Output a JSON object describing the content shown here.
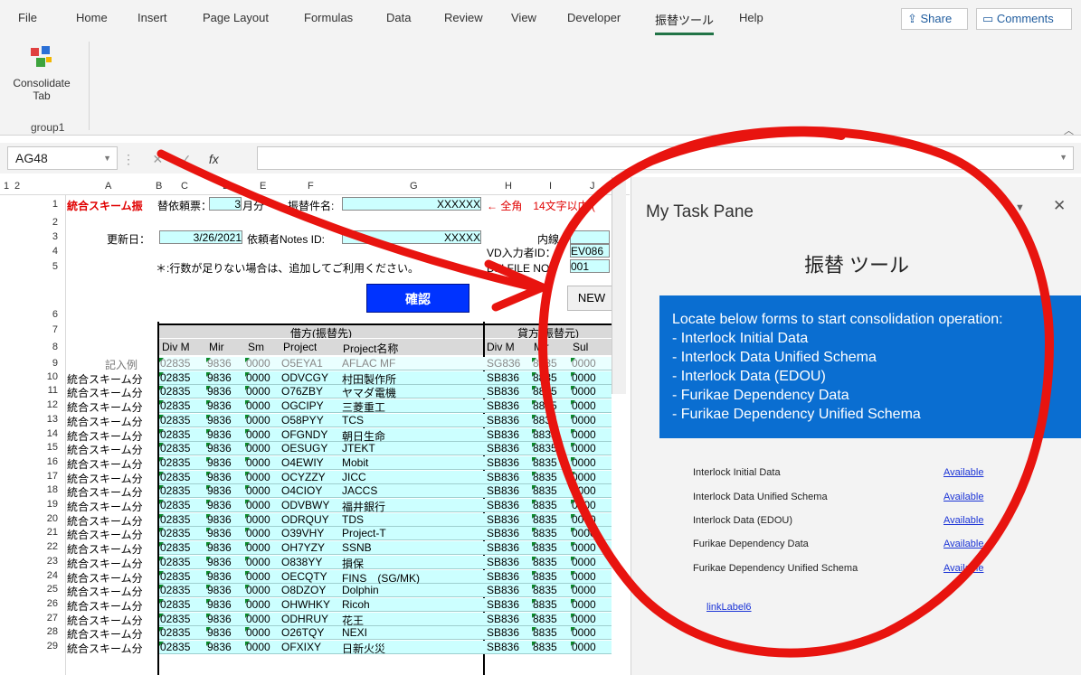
{
  "ribbon_tabs": [
    "File",
    "Home",
    "Insert",
    "Page Layout",
    "Formulas",
    "Data",
    "Review",
    "View",
    "Developer",
    "振替ツール",
    "Help"
  ],
  "share_label": "Share",
  "comments_label": "Comments",
  "consolidate_label_1": "Consolidate",
  "consolidate_label_2": "Tab",
  "group_label": "group1",
  "name_box": "AG48",
  "fx": "fx",
  "col_headers": [
    "A",
    "B",
    "C",
    "D",
    "E",
    "F",
    "G",
    "H",
    "I",
    "J"
  ],
  "outline_levels": [
    "1",
    "2"
  ],
  "header_rows": {
    "r1_title": "統合スキーム振",
    "r1_label": "替依頼票：",
    "r1_month": "3",
    "r1_month_unit": "月分",
    "r1_label2": "振替件名:",
    "r1_value": "XXXXXX",
    "r1_note": "← 全角　14文字以内 (",
    "r3_label": "更新日：",
    "r3_date": "3/26/2021",
    "r3_label2": "依頼者Notes ID:",
    "r3_value": "XXXXX",
    "r3_label3": "内線",
    "r4_label": "VD入力者ID：",
    "r4_value": "EV086",
    "r5_note": "＊:行数が足りない場合は、追加してご利用ください。",
    "r5_label": "DFI FILE NO.：",
    "r5_value": "001",
    "confirm_button": "確認",
    "new_button": "NEW",
    "r7_debit": "借方(振替先)",
    "r7_credit": "貸方(振替元)",
    "r8_cols": [
      "Div M",
      "Mir",
      "Sm",
      "Project",
      "Project名称",
      "Div M",
      "Mir",
      "Sul"
    ],
    "r9_example": "記入例"
  },
  "rows": [
    {
      "n": "9",
      "a": "",
      "c": "02835",
      "d": "9836",
      "e": "0000",
      "f": "O5EYA1",
      "g": "AFLAC MF",
      "h": "SG836",
      "i": "8835",
      "j": "0000"
    },
    {
      "n": "10",
      "a": "統合スキーム分",
      "c": "02835",
      "d": "9836",
      "e": "0000",
      "f": "ODVCGY",
      "g": "村田製作所",
      "h": "SB836",
      "i": "8835",
      "j": "0000"
    },
    {
      "n": "11",
      "a": "統合スキーム分",
      "c": "02835",
      "d": "9836",
      "e": "0000",
      "f": "O76ZBY",
      "g": "ヤマダ電機",
      "h": "SB836",
      "i": "8835",
      "j": "0000"
    },
    {
      "n": "12",
      "a": "統合スキーム分",
      "c": "02835",
      "d": "9836",
      "e": "0000",
      "f": "OGCIPY",
      "g": "三菱重工",
      "h": "SB836",
      "i": "8835",
      "j": "0000"
    },
    {
      "n": "13",
      "a": "統合スキーム分",
      "c": "02835",
      "d": "9836",
      "e": "0000",
      "f": "O58PYY",
      "g": "TCS",
      "h": "SB836",
      "i": "8835",
      "j": "0000"
    },
    {
      "n": "14",
      "a": "統合スキーム分",
      "c": "02835",
      "d": "9836",
      "e": "0000",
      "f": "OFGNDY",
      "g": "朝日生命",
      "h": "SB836",
      "i": "8835",
      "j": "0000"
    },
    {
      "n": "15",
      "a": "統合スキーム分",
      "c": "02835",
      "d": "9836",
      "e": "0000",
      "f": "OESUGY",
      "g": "JTEKT",
      "h": "SB836",
      "i": "8835",
      "j": "0000"
    },
    {
      "n": "16",
      "a": "統合スキーム分",
      "c": "02835",
      "d": "9836",
      "e": "0000",
      "f": "O4EWIY",
      "g": "Mobit",
      "h": "SB836",
      "i": "8835",
      "j": "0000"
    },
    {
      "n": "17",
      "a": "統合スキーム分",
      "c": "02835",
      "d": "9836",
      "e": "0000",
      "f": "OCYZZY",
      "g": "JICC",
      "h": "SB836",
      "i": "8835",
      "j": "0000"
    },
    {
      "n": "18",
      "a": "統合スキーム分",
      "c": "02835",
      "d": "9836",
      "e": "0000",
      "f": "O4CIOY",
      "g": "JACCS",
      "h": "SB836",
      "i": "8835",
      "j": "0000"
    },
    {
      "n": "19",
      "a": "統合スキーム分",
      "c": "02835",
      "d": "9836",
      "e": "0000",
      "f": "ODVBWY",
      "g": "福井銀行",
      "h": "SB836",
      "i": "8835",
      "j": "0000"
    },
    {
      "n": "20",
      "a": "統合スキーム分",
      "c": "02835",
      "d": "9836",
      "e": "0000",
      "f": "ODRQUY",
      "g": "TDS",
      "h": "SB836",
      "i": "8835",
      "j": "0000"
    },
    {
      "n": "21",
      "a": "統合スキーム分",
      "c": "02835",
      "d": "9836",
      "e": "0000",
      "f": "O39VHY",
      "g": "Project-T",
      "h": "SB836",
      "i": "8835",
      "j": "0000"
    },
    {
      "n": "22",
      "a": "統合スキーム分",
      "c": "02835",
      "d": "9836",
      "e": "0000",
      "f": "OH7YZY",
      "g": "SSNB",
      "h": "SB836",
      "i": "8835",
      "j": "0000"
    },
    {
      "n": "23",
      "a": "統合スキーム分",
      "c": "02835",
      "d": "9836",
      "e": "0000",
      "f": "O838YY",
      "g": "損保",
      "h": "SB836",
      "i": "8835",
      "j": "0000"
    },
    {
      "n": "24",
      "a": "統合スキーム分",
      "c": "02835",
      "d": "9836",
      "e": "0000",
      "f": "OECQTY",
      "g": "FINS　(SG/MK)",
      "h": "SB836",
      "i": "8835",
      "j": "0000"
    },
    {
      "n": "25",
      "a": "統合スキーム分",
      "c": "02835",
      "d": "9836",
      "e": "0000",
      "f": "O8DZOY",
      "g": "Dolphin",
      "h": "SB836",
      "i": "8835",
      "j": "0000"
    },
    {
      "n": "26",
      "a": "統合スキーム分",
      "c": "02835",
      "d": "9836",
      "e": "0000",
      "f": "OHWHKY",
      "g": "Ricoh",
      "h": "SB836",
      "i": "8835",
      "j": "0000"
    },
    {
      "n": "27",
      "a": "統合スキーム分",
      "c": "02835",
      "d": "9836",
      "e": "0000",
      "f": "ODHRUY",
      "g": "花王",
      "h": "SB836",
      "i": "8835",
      "j": "0000"
    },
    {
      "n": "28",
      "a": "統合スキーム分",
      "c": "02835",
      "d": "9836",
      "e": "0000",
      "f": "O26TQY",
      "g": "NEXI",
      "h": "SB836",
      "i": "8835",
      "j": "0000"
    },
    {
      "n": "29",
      "a": "統合スキーム分",
      "c": "02835",
      "d": "9836",
      "e": "0000",
      "f": "OFXIXY",
      "g": "日新火災",
      "h": "SB836",
      "i": "8835",
      "j": "0000"
    }
  ],
  "pane": {
    "title": "My Task Pane",
    "tool_title": "振替 ツール",
    "info_lines": [
      "Locate below forms to start consolidation operation:",
      " - Interlock Initial Data",
      " - Interlock Data Unified Schema",
      " - Interlock Data (EDOU)",
      " - Furikae Dependency Data",
      " - Furikae Dependency Unified Schema"
    ],
    "forms": [
      {
        "label": "Interlock Initial Data",
        "status": "Available"
      },
      {
        "label": "Interlock Data Unified Schema",
        "status": "Available"
      },
      {
        "label": "Interlock Data (EDOU)",
        "status": "Available"
      },
      {
        "label": "Furikae Dependency Data",
        "status": "Available"
      },
      {
        "label": "Furikae Dependency Unified Schema",
        "status": "Available"
      }
    ],
    "extra_link": "linkLabel6"
  },
  "colors": {
    "accent": "#217346",
    "info_box": "#0a6ed1",
    "annotation": "#e8140f",
    "cyan_fill": "#ccffff"
  }
}
